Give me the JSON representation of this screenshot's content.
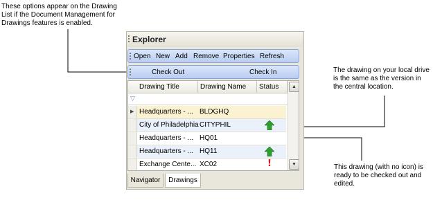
{
  "callouts": {
    "top": "These options appear on the Drawing List if the Document Management for Drawings features is enabled.",
    "right": "The drawing on your local drive is the same as the version in the central location.",
    "bottom": "This drawing (with no icon) is ready to be checked out and edited."
  },
  "panel": {
    "title": "Explorer",
    "toolbar": [
      "Open",
      "New",
      "Add",
      "Remove",
      "Properties",
      "Refresh"
    ],
    "checkout_bar": [
      "Check Out",
      "Check In"
    ],
    "columns": [
      "Drawing Title",
      "Drawing Name",
      "Status"
    ],
    "rows": [
      {
        "title": "Headquarters - ...",
        "name": "BLDGHQ",
        "status": ""
      },
      {
        "title": "City of Philadelphia",
        "name": "CITYPHIL",
        "status": "up-to-date-icon"
      },
      {
        "title": "Headquarters - ...",
        "name": "HQ01",
        "status": ""
      },
      {
        "title": "Headquarters - ...",
        "name": "HQ11",
        "status": "up-to-date-icon"
      },
      {
        "title": "Exchange Cente...",
        "name": "XC02",
        "status": "out-of-date-icon"
      }
    ],
    "tabs": [
      "Navigator",
      "Drawings"
    ]
  },
  "colors": {
    "up_to_date_green": "#2e9e2e",
    "out_of_date_red": "#d41a1a",
    "toolbar_blue": "#b9cdf2",
    "current_row": "#fbf2d2",
    "alt_row": "#eaf1fb"
  }
}
